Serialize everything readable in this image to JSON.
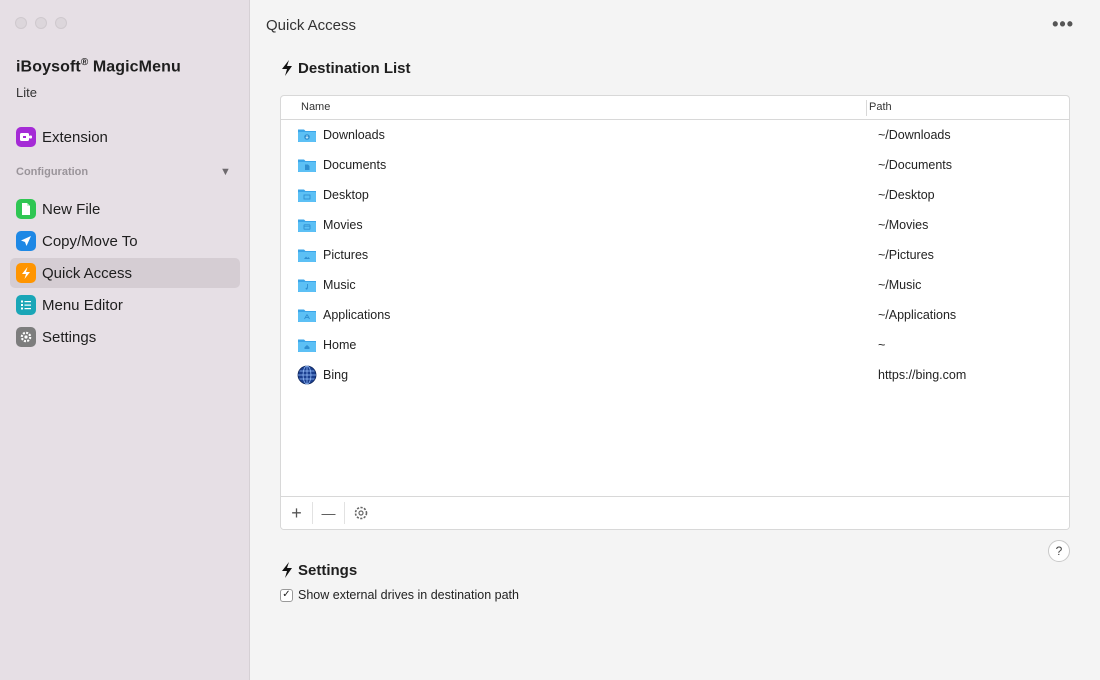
{
  "app": {
    "name": "iBoysoft",
    "reg": "®",
    "product": "MagicMenu",
    "edition": "Lite"
  },
  "sidebar": {
    "top_item": {
      "label": "Extension",
      "icon": "extension-icon",
      "color": "#a52bd6"
    },
    "section_label": "Configuration",
    "section_toggle": "▼",
    "items": [
      {
        "label": "New File",
        "icon": "new-file-icon",
        "color": "#2fc653"
      },
      {
        "label": "Copy/Move To",
        "icon": "send-icon",
        "color": "#1e88e5"
      },
      {
        "label": "Quick Access",
        "icon": "bolt-icon",
        "color": "#ff9500",
        "active": true
      },
      {
        "label": "Menu Editor",
        "icon": "list-icon",
        "color": "#1aa6b7"
      },
      {
        "label": "Settings",
        "icon": "gear-icon",
        "color": "#7d7d7d"
      }
    ]
  },
  "main": {
    "title": "Quick Access",
    "more": "•••",
    "destination_heading": "Destination List",
    "columns": {
      "name": "Name",
      "path": "Path"
    },
    "rows": [
      {
        "name": "Downloads",
        "path": "~/Downloads",
        "icon": "downloads-folder-icon"
      },
      {
        "name": "Documents",
        "path": "~/Documents",
        "icon": "documents-folder-icon"
      },
      {
        "name": "Desktop",
        "path": "~/Desktop",
        "icon": "desktop-folder-icon"
      },
      {
        "name": "Movies",
        "path": "~/Movies",
        "icon": "movies-folder-icon"
      },
      {
        "name": "Pictures",
        "path": "~/Pictures",
        "icon": "pictures-folder-icon"
      },
      {
        "name": "Music",
        "path": "~/Music",
        "icon": "music-folder-icon"
      },
      {
        "name": "Applications",
        "path": "~/Applications",
        "icon": "applications-folder-icon"
      },
      {
        "name": "Home",
        "path": "~",
        "icon": "home-folder-icon"
      },
      {
        "name": "Bing",
        "path": "https://bing.com",
        "icon": "globe-icon"
      }
    ],
    "toolbar": {
      "add": "+",
      "remove": "—",
      "options": "⚙"
    },
    "help": "?",
    "settings_heading": "Settings",
    "show_external_label": "Show external drives in destination path",
    "show_external_checked": true,
    "check_mark": "✓"
  }
}
